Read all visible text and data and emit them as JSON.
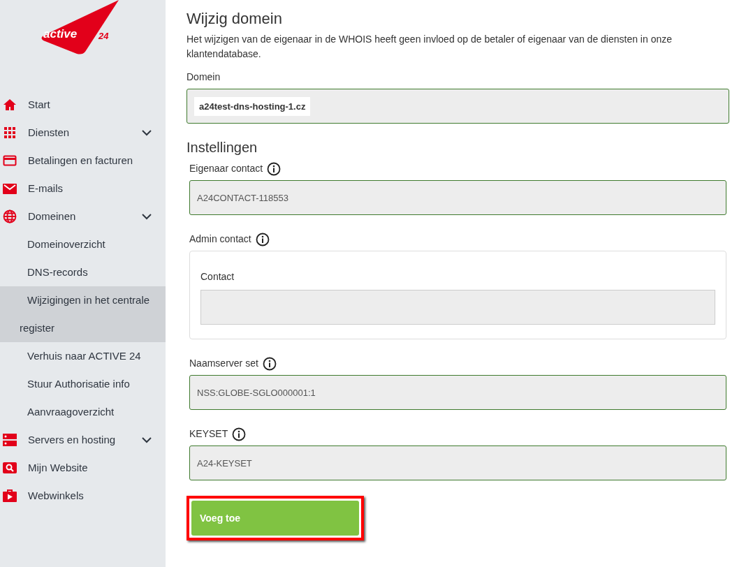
{
  "logo": {
    "word": "active",
    "number": "24"
  },
  "sidebar": {
    "items": [
      {
        "label": "Start",
        "expandable": false,
        "selected": false
      },
      {
        "label": "Diensten",
        "expandable": true,
        "selected": false
      },
      {
        "label": "Betalingen en facturen",
        "expandable": false,
        "selected": false
      },
      {
        "label": "E-mails",
        "expandable": false,
        "selected": false
      },
      {
        "label": "Domeinen",
        "expandable": true,
        "selected": false,
        "children": [
          {
            "label": "Domeinoverzicht",
            "selected": false
          },
          {
            "label": "DNS-records",
            "selected": false
          },
          {
            "label": "Wijzigingen in het centrale register",
            "selected": true
          },
          {
            "label": "Verhuis naar ACTIVE 24",
            "selected": false
          },
          {
            "label": "Stuur Authorisatie info",
            "selected": false
          },
          {
            "label": "Aanvraagoverzicht",
            "selected": false
          }
        ]
      },
      {
        "label": "Servers en hosting",
        "expandable": true,
        "selected": false
      },
      {
        "label": "Mijn Website",
        "expandable": false,
        "selected": false
      },
      {
        "label": "Webwinkels",
        "expandable": false,
        "selected": false
      }
    ]
  },
  "page": {
    "title": "Wijzig domein",
    "description": "Het wijzigen van de eigenaar in de WHOIS heeft geen invloed op de betaler of eigenaar van de diensten in onze klantendatabase.",
    "domain": {
      "label": "Domein",
      "value": "a24test-dns-hosting-1.cz"
    },
    "section_title": "Instellingen",
    "fields": [
      {
        "kind": "field",
        "label": "Eigenaar contact",
        "value": "A24CONTACT-118553"
      },
      {
        "kind": "panel",
        "label": "Admin contact",
        "inner_label": "Contact"
      },
      {
        "kind": "field",
        "label": "Naamserver set",
        "value": "NSS:GLOBE-SGLO000001:1"
      },
      {
        "kind": "field",
        "label": "KEYSET",
        "value": "A24-KEYSET"
      }
    ],
    "button": {
      "label": "Voeg toe",
      "highlighted": true
    }
  }
}
